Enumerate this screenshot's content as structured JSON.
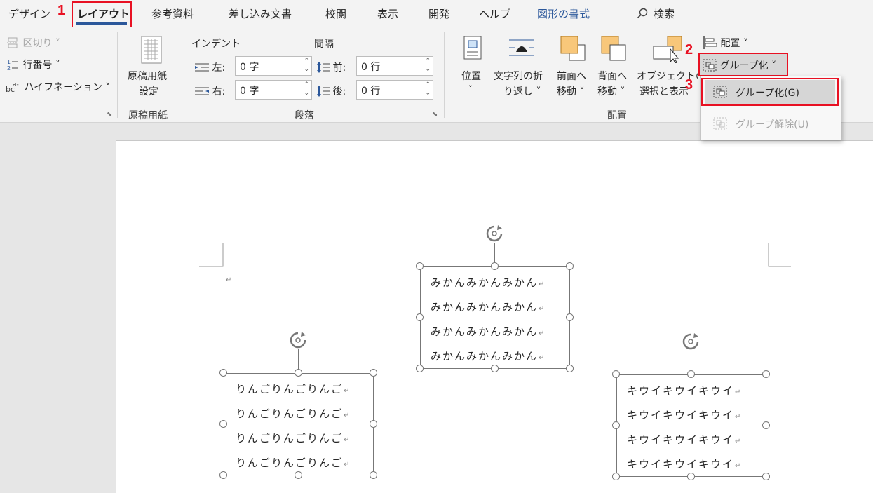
{
  "tabs": [
    {
      "label": "デザイン"
    },
    {
      "label": "レイアウト"
    },
    {
      "label": "参考資料"
    },
    {
      "label": "差し込み文書"
    },
    {
      "label": "校閲"
    },
    {
      "label": "表示"
    },
    {
      "label": "開発"
    },
    {
      "label": "ヘルプ"
    },
    {
      "label": "図形の書式"
    }
  ],
  "search_label": "検索",
  "steps": [
    "1",
    "2",
    "3"
  ],
  "page_setup": {
    "breaks": "区切り",
    "line_numbers": "行番号",
    "hyphenation": "ハイフネーション"
  },
  "manuscript": {
    "button_line1": "原稿用紙",
    "button_line2": "設定",
    "group_label": "原稿用紙"
  },
  "paragraph": {
    "indent_header": "インデント",
    "spacing_header": "間隔",
    "left_label": "左:",
    "right_label": "右:",
    "before_label": "前:",
    "after_label": "後:",
    "left_value": "0 字",
    "right_value": "0 字",
    "before_value": "0 行",
    "after_value": "0 行",
    "group_label": "段落"
  },
  "arrange": {
    "position_label": "位置",
    "wrap_line1": "文字列の折",
    "wrap_line2": "り返し",
    "forward_line1": "前面へ",
    "forward_line2": "移動",
    "backward_line1": "背面へ",
    "backward_line2": "移動",
    "selection_line1": "オブジェクトの",
    "selection_line2": "選択と表示",
    "align_label": "配置",
    "group_label": "グループ化",
    "section_label": "配置"
  },
  "group_menu": {
    "group_item": "グループ化(G)",
    "ungroup_item": "グループ解除(U)"
  },
  "textboxes": {
    "mikan": [
      "みかんみかんみかん",
      "みかんみかんみかん",
      "みかんみかんみかん",
      "みかんみかんみかん"
    ],
    "ringo": [
      "りんごりんごりんご",
      "りんごりんごりんご",
      "りんごりんごりんご",
      "りんごりんごりんご"
    ],
    "kiwi": [
      "キウイキウイキウイ",
      "キウイキウイキウイ",
      "キウイキウイキウイ",
      "キウイキウイキウイ"
    ]
  },
  "colors": {
    "accent": "#2b579a",
    "highlight": "#e81123",
    "shape_orange": "#f8c77a"
  }
}
